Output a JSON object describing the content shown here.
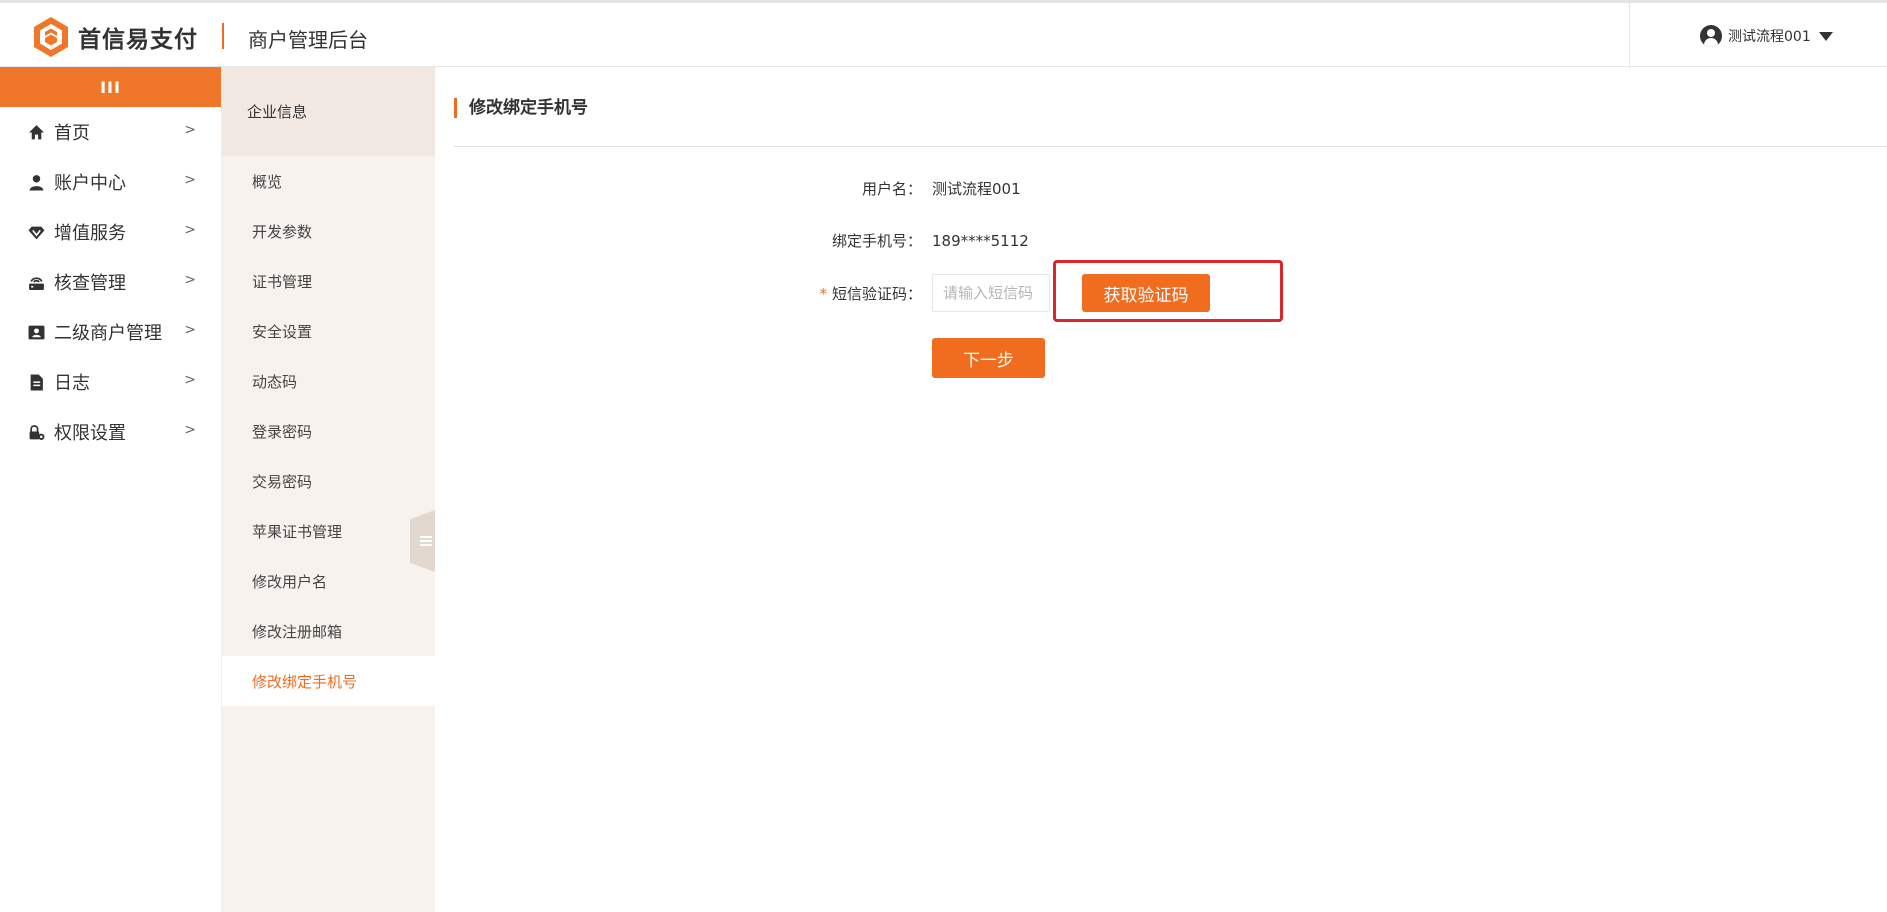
{
  "header": {
    "brand_name": "首信易支付",
    "app_title": "商户管理后台",
    "username": "测试流程001"
  },
  "sidebar": {
    "toggle_label": "III",
    "items": [
      {
        "label": "首页",
        "icon": "home-icon"
      },
      {
        "label": "账户中心",
        "icon": "user-icon"
      },
      {
        "label": "增值服务",
        "icon": "diamond-icon"
      },
      {
        "label": "核查管理",
        "icon": "router-icon"
      },
      {
        "label": "二级商户管理",
        "icon": "id-card-icon"
      },
      {
        "label": "日志",
        "icon": "document-icon"
      },
      {
        "label": "权限设置",
        "icon": "lock-gear-icon"
      }
    ]
  },
  "subnav": {
    "header": "企业信息",
    "items": [
      {
        "label": "概览",
        "active": false
      },
      {
        "label": "开发参数",
        "active": false
      },
      {
        "label": "证书管理",
        "active": false
      },
      {
        "label": "安全设置",
        "active": false
      },
      {
        "label": "动态码",
        "active": false
      },
      {
        "label": "登录密码",
        "active": false
      },
      {
        "label": "交易密码",
        "active": false
      },
      {
        "label": "苹果证书管理",
        "active": false
      },
      {
        "label": "修改用户名",
        "active": false
      },
      {
        "label": "修改注册邮箱",
        "active": false
      },
      {
        "label": "修改绑定手机号",
        "active": true
      }
    ]
  },
  "page": {
    "title": "修改绑定手机号",
    "form": {
      "username_label": "用户名：",
      "username_value": "测试流程001",
      "phone_label": "绑定手机号：",
      "phone_value": "189****5112",
      "required_mark": "*",
      "sms_label": "短信验证码：",
      "sms_placeholder": "请输入短信码",
      "get_code_label": "获取验证码",
      "next_label": "下一步"
    }
  },
  "colors": {
    "accent": "#f06d1f",
    "highlight": "#d9272a",
    "subnav_bg": "#f7f2ee"
  }
}
